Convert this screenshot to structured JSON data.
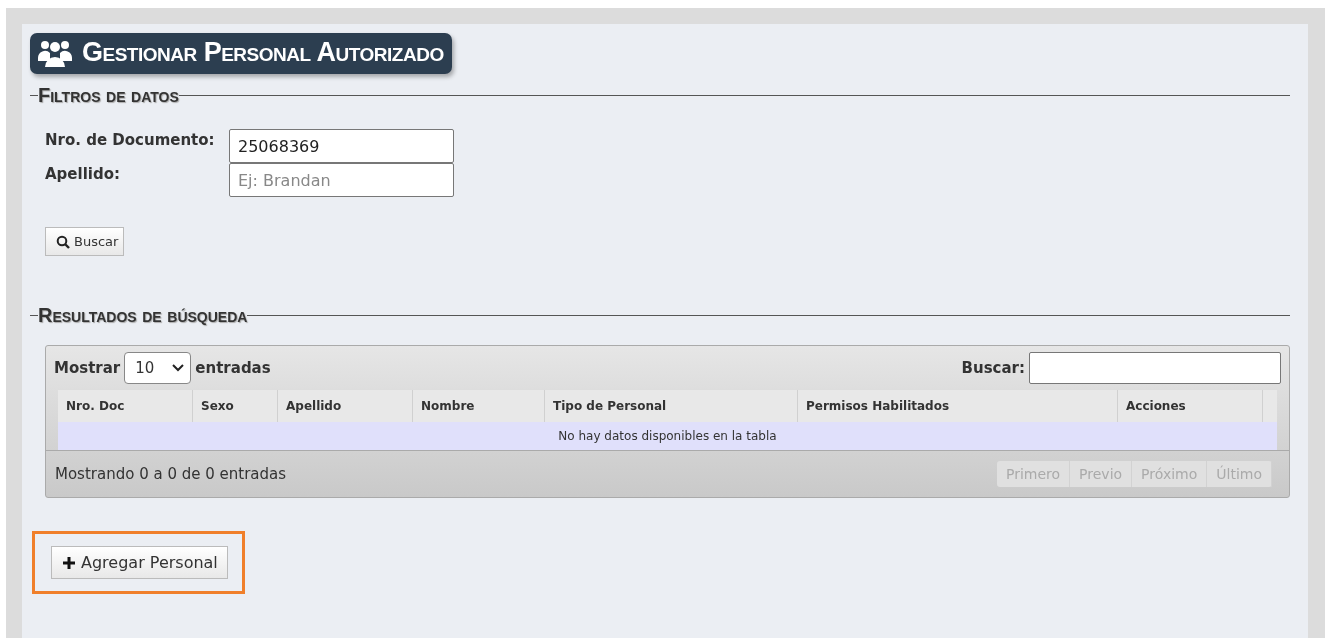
{
  "header": {
    "title": "Gestionar Personal Autorizado"
  },
  "filters": {
    "legend": "Filtros de datos",
    "fields": [
      {
        "label": "Nro. de Documento:",
        "value": "25068369"
      },
      {
        "label": "Apellido:",
        "placeholder": "Ej: Brandan"
      }
    ],
    "search_button": "Buscar"
  },
  "results": {
    "legend": "Resultados de búsqueda",
    "length_label": "Mostrar",
    "length_value": "10",
    "length_suffix": "entradas",
    "search_label": "Buscar:",
    "columns": [
      "Nro. Doc",
      "Sexo",
      "Apellido",
      "Nombre",
      "Tipo de Personal",
      "Permisos Habilitados",
      "Acciones"
    ],
    "empty_message": "No hay datos disponibles en la tabla",
    "info": "Mostrando 0 a 0 de 0 entradas",
    "pager": [
      {
        "label": "Primero",
        "disabled": true
      },
      {
        "label": "Previo",
        "disabled": true
      },
      {
        "label": "Próximo",
        "disabled": true
      },
      {
        "label": "Último",
        "disabled": true
      }
    ]
  },
  "add_button": {
    "label": "Agregar Personal",
    "highlighted": true
  }
}
